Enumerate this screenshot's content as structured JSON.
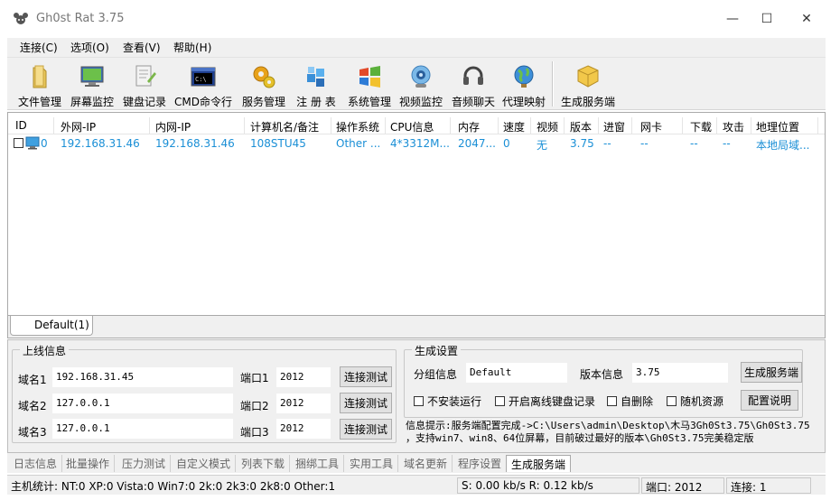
{
  "window": {
    "title": "Gh0st Rat 3.75",
    "minimize": "—",
    "maximize": "☐",
    "close": "✕"
  },
  "menu": [
    "连接(C)",
    "选项(O)",
    "查看(V)",
    "帮助(H)"
  ],
  "toolbar": [
    {
      "label": "文件管理",
      "icon": "folder-icon"
    },
    {
      "label": "屏幕监控",
      "icon": "monitor-icon"
    },
    {
      "label": "键盘记录",
      "icon": "keyboard-log-icon"
    },
    {
      "label": "CMD命令行",
      "icon": "cmd-icon"
    },
    {
      "label": "服务管理",
      "icon": "gears-icon"
    },
    {
      "label": "注 册 表",
      "icon": "registry-icon"
    },
    {
      "label": "系统管理",
      "icon": "windows-icon"
    },
    {
      "label": "视频监控",
      "icon": "webcam-icon"
    },
    {
      "label": "音频聊天",
      "icon": "headset-icon"
    },
    {
      "label": "代理映射",
      "icon": "globe-icon"
    },
    {
      "label": "生成服务端",
      "icon": "package-icon"
    }
  ],
  "list": {
    "columns": [
      "ID",
      "外网-IP",
      "内网-IP",
      "计算机名/备注",
      "操作系统",
      "CPU信息",
      "内存",
      "速度",
      "视频",
      "版本",
      "进窗",
      "网卡",
      "下载",
      "攻击",
      "地理位置"
    ],
    "rows": [
      [
        "0",
        "192.168.31.46",
        "192.168.31.46",
        "108STU45",
        "Other ...",
        "4*3312M...",
        "2047...",
        "0",
        "无",
        "3.75",
        "--",
        "--",
        "--",
        "--",
        "本地局域..."
      ]
    ]
  },
  "group_tab": "Default(1)",
  "online_info": {
    "title": "上线信息",
    "rows": [
      {
        "domain_label": "域名1",
        "domain": "192.168.31.45",
        "port_label": "端口1",
        "port": "2012",
        "button": "连接测试"
      },
      {
        "domain_label": "域名2",
        "domain": "127.0.0.1",
        "port_label": "端口2",
        "port": "2012",
        "button": "连接测试"
      },
      {
        "domain_label": "域名3",
        "domain": "127.0.0.1",
        "port_label": "端口3",
        "port": "2012",
        "button": "连接测试"
      }
    ]
  },
  "build": {
    "title": "生成设置",
    "group_label": "分组信息",
    "group_value": "Default",
    "version_label": "版本信息",
    "version_value": "3.75",
    "build_button": "生成服务端",
    "config_button": "配置说明",
    "chk_no_install": "不安装运行",
    "chk_offline_keylog": "开启离线键盘记录",
    "chk_self_delete": "自删除",
    "chk_random_res": "随机资源",
    "info_line1": "信息提示:服务端配置完成->C:\\Users\\admin\\Desktop\\木马3Gh0St3.75\\Gh0St3.75",
    "info_line2": "，支持win7、win8、64位屏幕，目前破过最好的版本\\Gh0St3.75完美稳定版"
  },
  "bottom_tabs": [
    "日志信息",
    "批量操作",
    "压力测试",
    "自定义模式",
    "列表下载",
    "捆绑工具",
    "实用工具",
    "域名更新",
    "程序设置",
    "生成服务端"
  ],
  "active_tab": "生成服务端",
  "status": {
    "hosts": "主机统计:  NT:0  XP:0  Vista:0  Win7:0  2k:0  2k3:0  2k8:0  Other:1",
    "speed": "S: 0.00 kb/s R: 0.12 kb/s",
    "port": "端口: 2012",
    "connections": "连接: 1"
  },
  "colors": {
    "list_text": "#1a8fd6",
    "background": "#f0f0f0"
  }
}
